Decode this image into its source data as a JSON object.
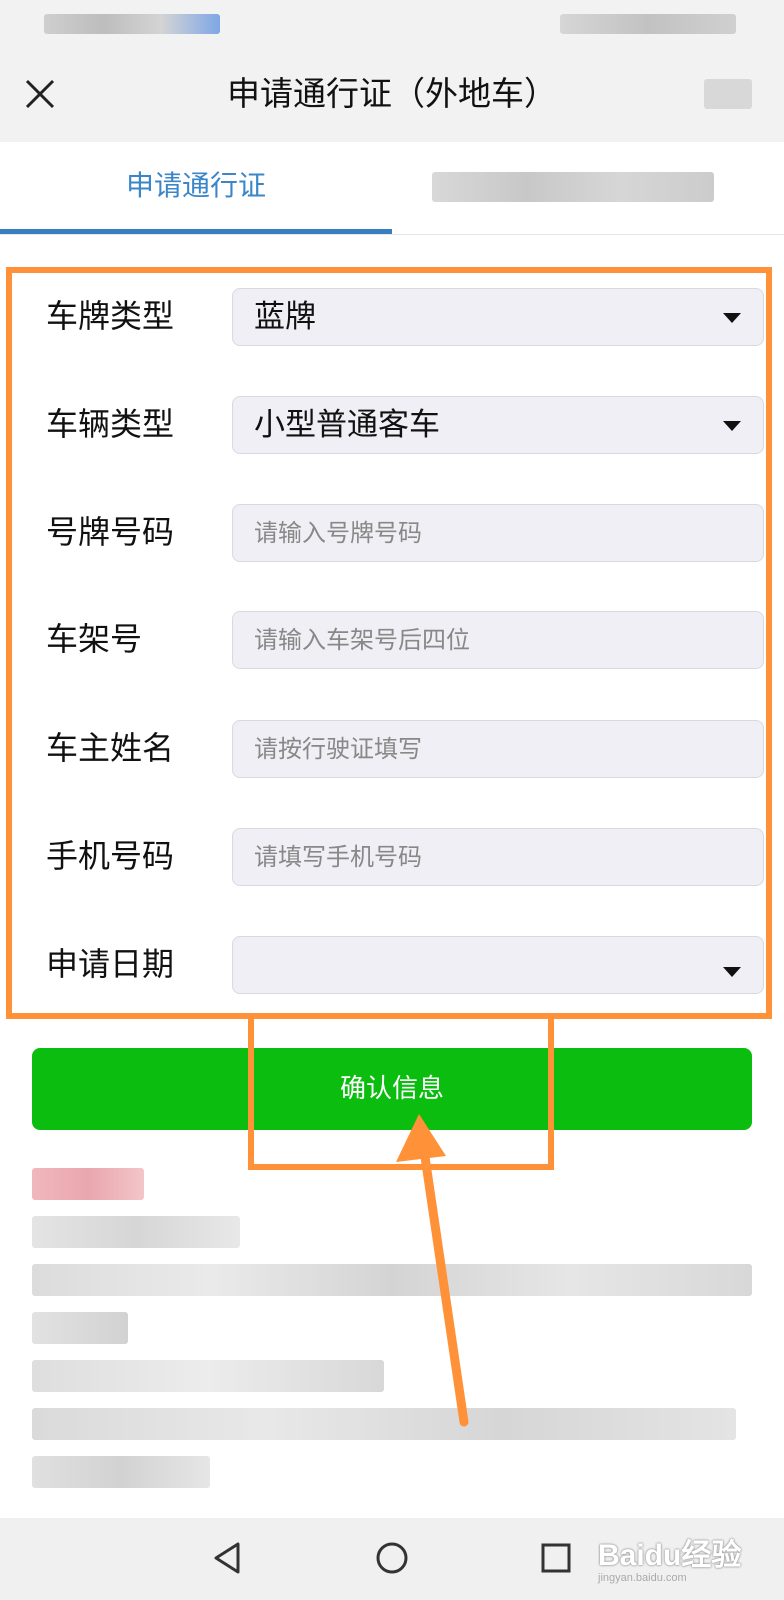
{
  "header": {
    "title": "申请通行证（外地车）"
  },
  "tabs": [
    {
      "label": "申请通行证",
      "active": true
    }
  ],
  "form": {
    "plate_type": {
      "label": "车牌类型",
      "value": "蓝牌"
    },
    "vehicle_type": {
      "label": "车辆类型",
      "value": "小型普通客车"
    },
    "plate_number": {
      "label": "号牌号码",
      "placeholder": "请输入号牌号码"
    },
    "vin": {
      "label": "车架号",
      "placeholder": "请输入车架号后四位"
    },
    "owner_name": {
      "label": "车主姓名",
      "placeholder": "请按行驶证填写"
    },
    "phone": {
      "label": "手机号码",
      "placeholder": "请填写手机号码"
    },
    "apply_date": {
      "label": "申请日期",
      "value": ""
    }
  },
  "actions": {
    "confirm_label": "确认信息"
  },
  "watermark": {
    "logo": "Baidu经验",
    "url": "jingyan.baidu.com"
  },
  "colors": {
    "accent_blue": "#3a7ec2",
    "button_green": "#0bbd0f",
    "annotation_orange": "#ff9239"
  }
}
